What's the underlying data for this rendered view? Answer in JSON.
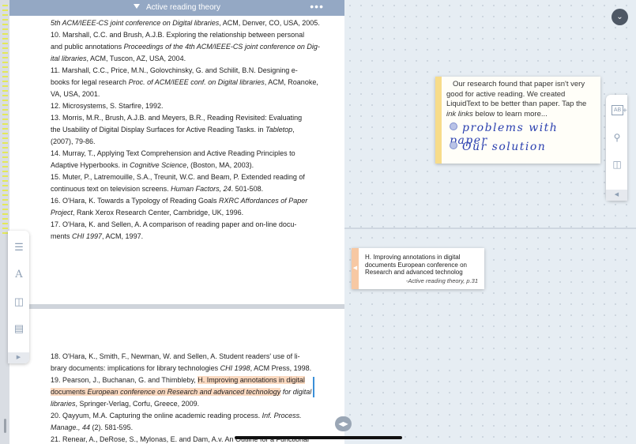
{
  "document": {
    "title": "Active reading theory",
    "more_label": "•••",
    "references_top": [
      {
        "lines": [
          [
            "",
            "5th ACM/IEEE-CS joint conference on Digital libraries",
            ", ACM, Denver, CO, USA, 2005."
          ]
        ]
      },
      {
        "lines": [
          [
            "10.      Marshall, C.C. and Brush, A.J.B. Exploring the relationship between personal",
            "",
            ""
          ],
          [
            "and public annotations ",
            "Proceedings of the 4th ACM/IEEE-CS joint conference on Dig-",
            ""
          ],
          [
            "",
            "ital libraries",
            ", ACM, Tuscon, AZ, USA, 2004."
          ]
        ]
      },
      {
        "lines": [
          [
            "11.      Marshall, C.C., Price, M.N., Golovchinsky, G. and Schilit, B.N. Designing e-",
            "",
            ""
          ],
          [
            "books for legal research ",
            "Proc. of ACM/IEEE conf. on Digital libraries",
            ", ACM, Roanoke,"
          ],
          [
            "VA, USA, 2001.",
            "",
            ""
          ]
        ]
      },
      {
        "lines": [
          [
            "12.      Microsystems, S. Starfire, 1992.",
            "",
            ""
          ]
        ]
      },
      {
        "lines": [
          [
            "13.      Morris, M.R., Brush, A.J.B. and Meyers, B.R., Reading Revisited: Evaluating",
            "",
            ""
          ],
          [
            "the Usability of Digital Display Surfaces for Active Reading Tasks. in ",
            "Tabletop",
            ","
          ],
          [
            "(2007), 79-86.",
            "",
            ""
          ]
        ]
      },
      {
        "lines": [
          [
            "14.      Murray, T., Applying Text Comprehension and Active Reading Principles to",
            "",
            ""
          ],
          [
            "Adaptive Hyperbooks. in ",
            "Cognitive Science",
            ", (Boston, MA, 2003)."
          ]
        ]
      },
      {
        "lines": [
          [
            "15.      Muter, P., Latremouille, S.A., Treunit, W.C. and Beam, P. Extended reading of",
            "",
            ""
          ],
          [
            "continuous text on television screens. ",
            "Human Factors, 24",
            ". 501-508."
          ]
        ]
      },
      {
        "lines": [
          [
            "16.      O'Hara, K. Towards a Typology of Reading Goals ",
            "RXRC Affordances of Paper",
            ""
          ],
          [
            "",
            "Project",
            ", Rank Xerox Research Center, Cambridge, UK, 1996."
          ]
        ]
      },
      {
        "lines": [
          [
            "17.      O'Hara, K. and Sellen, A. A comparison of reading paper and on-line docu-",
            "",
            ""
          ],
          [
            "ments ",
            "CHI 1997",
            ", ACM, 1997."
          ]
        ]
      }
    ],
    "references_bottom": {
      "r18": [
        "18.      O'Hara, K., Smith, F., Newman, W. and Sellen, A. Student readers' use of li-",
        "brary documents: implications for library technologies ",
        "CHI 1998",
        ", ACM Press, 1998."
      ],
      "r19_a": "19.      Pearson, J., Buchanan, G. and Thimbleby, ",
      "r19_hl1": "H. Improving annotations in digital",
      "r19_hl2a": "documents ",
      "r19_hl2b": "European conference on Research and advanced technology",
      "r19_b": " for digital",
      "r19_c1": "libraries",
      "r19_c2": ", Springer-Verlag, Corfu, Greece, 2009.",
      "r20": [
        "20.      Qayyum, M.A. Capturing the online academic reading process. ",
        "Inf. Process.",
        "Manage.",
        ", 44",
        " (2). 581-595."
      ],
      "r21": "21.      Renear, A., DeRose, S., Mylonas, E. and Dam, A.v. An Outline for a Functional"
    }
  },
  "note": {
    "text_1": "Our research found that paper isn't very good for active reading. We created LiquidText to be better than paper. Tap the ",
    "text_em": "ink links",
    "text_2": " below to learn more...",
    "link_1": "problems with paper",
    "link_2": "Our solution"
  },
  "excerpt": {
    "text": "H. Improving annotations in digital documents European conference on Research and advanced technolog",
    "source": "-Active reading theory, p.31"
  },
  "colors": {
    "header": "#94a8c4",
    "highlight": "#fbd9c0",
    "note_tab": "#f7dc8a",
    "excerpt_tab": "#f7c8a3",
    "ink": "#2b40b0"
  },
  "icons": {
    "left_toolbar": [
      "list-collapse-icon",
      "font-icon",
      "add-page-icon",
      "add-comment-icon",
      "chevron-right-icon"
    ],
    "right_toolbar": [
      "ab-text-icon",
      "zoom-out-icon",
      "add-page-icon",
      "chevron-left-icon"
    ],
    "collapse": "chevron-down-icon"
  }
}
